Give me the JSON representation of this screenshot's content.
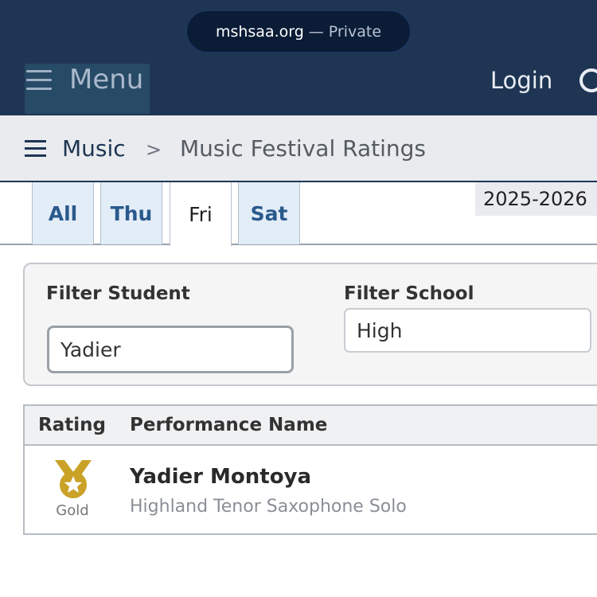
{
  "browser": {
    "url": "mshsaa.org",
    "separator": "—",
    "mode": "Private"
  },
  "header": {
    "menu_label": "Menu",
    "login_label": "Login",
    "search_icon": "search-icon"
  },
  "breadcrumb": {
    "root": "Music",
    "separator": ">",
    "current": "Music Festival Ratings"
  },
  "tabs": [
    {
      "label": "All",
      "active": false
    },
    {
      "label": "Thu",
      "active": false
    },
    {
      "label": "Fri",
      "active": true
    },
    {
      "label": "Sat",
      "active": false
    }
  ],
  "season": "2025-2026",
  "filters": {
    "student_label": "Filter Student",
    "student_value": "Yadier",
    "school_label": "Filter School",
    "school_value": "High"
  },
  "table": {
    "columns": [
      "Rating",
      "Performance Name"
    ],
    "rows": [
      {
        "rating": "Gold",
        "rating_icon": "gold-medal-icon",
        "name": "Yadier Montoya",
        "detail": "Highland Tenor Saxophone Solo"
      }
    ]
  },
  "colors": {
    "header_bg": "#1e3553",
    "link_blue": "#2a5a8c",
    "gold": "#c9a227"
  }
}
